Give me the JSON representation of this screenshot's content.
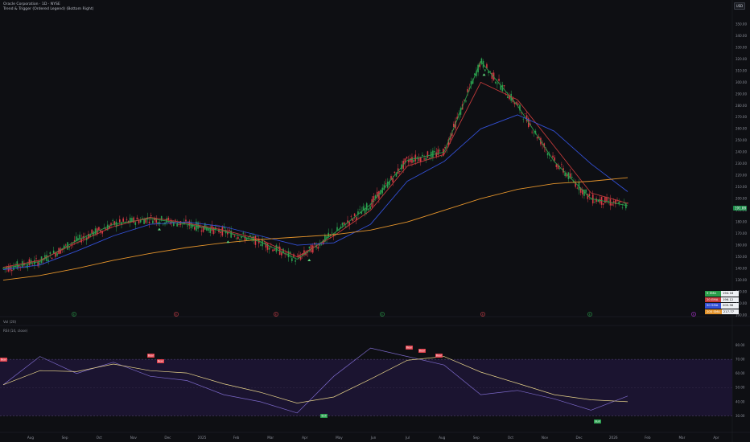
{
  "header": {
    "symbol_line": "Oracle Corporation · 1D · NYSE",
    "indicator_line": "Trend & Trigger (Ordered Legend) (Bottom Right)",
    "currency": "USD"
  },
  "price_axis": {
    "labels": [
      "350.00",
      "340.00",
      "330.00",
      "320.00",
      "310.00",
      "300.00",
      "290.00",
      "280.00",
      "270.00",
      "260.00",
      "250.00",
      "240.00",
      "230.00",
      "220.00",
      "210.00",
      "200.00",
      "190.00",
      "180.00",
      "170.00",
      "160.00",
      "150.00",
      "140.00",
      "130.00",
      "120.00",
      "110.00",
      "100.00"
    ],
    "current_price": "191.88",
    "current_color": "#1d8c4a"
  },
  "time_axis": {
    "labels": [
      "Aug",
      "Sep",
      "Oct",
      "Nov",
      "Dec",
      "2025",
      "Feb",
      "Mar",
      "Apr",
      "May",
      "Jun",
      "Jul",
      "Aug",
      "Sep",
      "Oct",
      "Nov",
      "Dec",
      "2026",
      "Feb",
      "Mar",
      "Apr"
    ]
  },
  "legend": [
    {
      "name": "9 EMA",
      "value": "194.18",
      "color": "#2a9d4a"
    },
    {
      "name": "20 EMA",
      "value": "196.12",
      "color": "#c23a3a"
    },
    {
      "name": "50 SMA",
      "value": "205.96",
      "color": "#3350d6"
    },
    {
      "name": "200 SMA",
      "value": "217.77",
      "color": "#e3932b"
    }
  ],
  "event_markers": [
    {
      "glyph": "E",
      "color": "#2a9d4a"
    },
    {
      "glyph": "E",
      "color": "#d0404a"
    },
    {
      "glyph": "E",
      "color": "#d0404a"
    },
    {
      "glyph": "E",
      "color": "#2a9d4a"
    },
    {
      "glyph": "E",
      "color": "#d0404a"
    },
    {
      "glyph": "E",
      "color": "#2a9d4a"
    },
    {
      "glyph": "E",
      "color": "#b036d4"
    }
  ],
  "volume_pane": {
    "label": "Vol (20)"
  },
  "rsi_pane": {
    "label": "RSI (14, close)",
    "axis": [
      "80.00",
      "70.00",
      "60.00",
      "50.00",
      "40.00",
      "30.00"
    ],
    "divergence_tags": [
      {
        "text": "Bear"
      },
      {
        "text": "Bear"
      },
      {
        "text": "Bear"
      },
      {
        "text": "Bear"
      },
      {
        "text": "Bear"
      },
      {
        "text": "Bear"
      },
      {
        "text": "Bull"
      },
      {
        "text": "Bull"
      }
    ]
  },
  "chart_data": {
    "type": "line",
    "title": "",
    "x": [
      "Aug",
      "Sep",
      "Oct",
      "Nov",
      "Dec",
      "2025",
      "Feb",
      "Mar",
      "Apr",
      "May",
      "Jun",
      "Jul",
      "Aug",
      "Sep",
      "Oct",
      "Nov",
      "Dec",
      "2026"
    ],
    "series": [
      {
        "name": "9 EMA",
        "values": [
          140,
          146,
          164,
          178,
          183,
          178,
          172,
          163,
          148,
          170,
          195,
          233,
          240,
          318,
          280,
          232,
          200,
          194
        ]
      },
      {
        "name": "20 EMA",
        "values": [
          141,
          147,
          162,
          176,
          184,
          179,
          173,
          165,
          150,
          168,
          190,
          228,
          238,
          300,
          285,
          245,
          205,
          196
        ]
      },
      {
        "name": "50 SMA",
        "values": [
          139,
          143,
          155,
          168,
          178,
          180,
          176,
          168,
          160,
          162,
          178,
          215,
          232,
          260,
          272,
          258,
          230,
          206
        ]
      },
      {
        "name": "200 SMA",
        "values": [
          130,
          134,
          140,
          147,
          153,
          158,
          162,
          165,
          167,
          169,
          173,
          180,
          190,
          200,
          208,
          213,
          215,
          218
        ]
      }
    ],
    "rsi": [
      52,
      72,
      60,
      68,
      58,
      55,
      45,
      40,
      32,
      58,
      78,
      72,
      66,
      45,
      48,
      42,
      34,
      44
    ],
    "ylim": [
      100,
      350
    ]
  }
}
